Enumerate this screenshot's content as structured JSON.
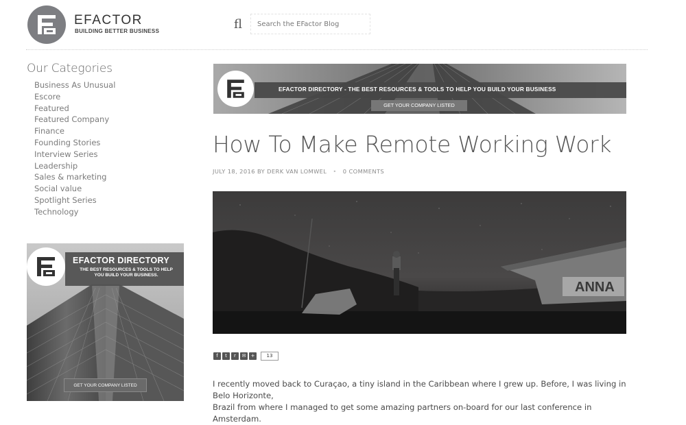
{
  "header": {
    "brand_name": "EFACTOR",
    "brand_tagline": "BUILDING BETTER BUSINESS",
    "search_glyph": "fl",
    "search_placeholder": "Search the EFactor Blog",
    "logo_icon": "efactor-logo-icon",
    "colors": {
      "logo_circle": "#7d7e82",
      "logo_mark": "#ffffff"
    }
  },
  "sidebar": {
    "categories_title": "Our Categories",
    "categories": [
      "Business As Unusual",
      "Escore",
      "Featured",
      "Featured Company",
      "Finance",
      "Founding Stories",
      "Interview Series",
      "Leadership",
      "Sales & marketing",
      "Social value",
      "Spotlight Series",
      "Technology"
    ],
    "ad": {
      "title": "EFACTOR DIRECTORY",
      "subtitle": "THE BEST RESOURCES & TOOLS TO HELP YOU BUILD YOUR BUSINESS.",
      "cta": "GET YOUR COMPANY LISTED"
    }
  },
  "banner": {
    "headline": "EFACTOR DIRECTORY - THE BEST RESOURCES & TOOLS TO HELP YOU BUILD YOUR BUSINESS",
    "cta": "GET YOUR COMPANY LISTED"
  },
  "post": {
    "title": "How To Make Remote Working Work",
    "date": "JULY 18, 2016",
    "by": "BY",
    "author": "DERK VAN LOMWEL",
    "separator": "•",
    "comments": "0 COMMENTS",
    "hero_image_caption_text": "ANNA",
    "share": {
      "buttons": [
        {
          "icon": "facebook-icon",
          "glyph": "f"
        },
        {
          "icon": "twitter-icon",
          "glyph": "t"
        },
        {
          "icon": "reddit-icon",
          "glyph": "r"
        },
        {
          "icon": "email-icon",
          "glyph": "✉"
        },
        {
          "icon": "plus-icon",
          "glyph": "+"
        }
      ],
      "count": "13"
    },
    "body_line_1": "I recently moved back to Curaçao, a tiny island in the Caribbean where I grew up. Before, I was living in Belo Horizonte,",
    "body_line_2": "Brazil from where I managed to get some amazing partners on-board for our last conference in Amsterdam."
  }
}
